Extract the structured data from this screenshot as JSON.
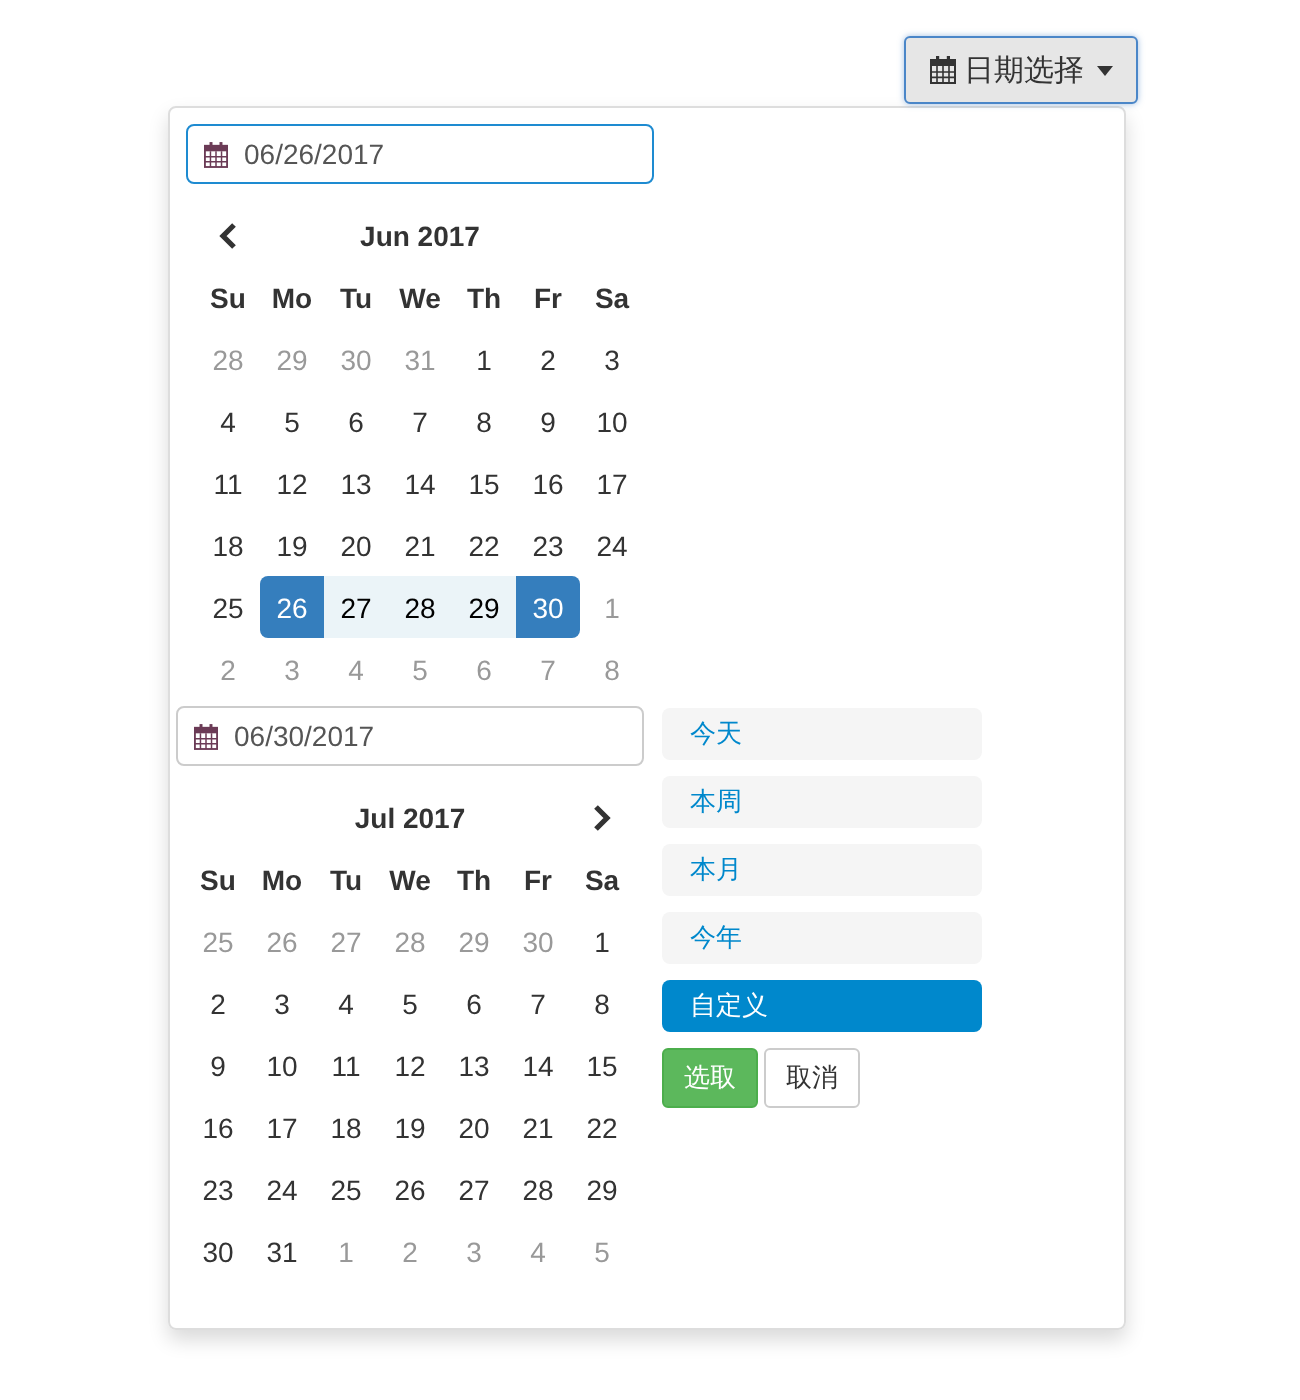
{
  "toggle_button": {
    "label": "日期选择"
  },
  "calendars": [
    {
      "date_field": {
        "value": "06/26/2017",
        "focused": true
      },
      "prev_arrow": true,
      "next_arrow": false,
      "month": "Jun 2017",
      "weekdays": [
        "Su",
        "Mo",
        "Tu",
        "We",
        "Th",
        "Fr",
        "Sa"
      ],
      "weeks": [
        [
          {
            "day": "28",
            "kind": "off"
          },
          {
            "day": "29",
            "kind": "off"
          },
          {
            "day": "30",
            "kind": "off"
          },
          {
            "day": "31",
            "kind": "off"
          },
          {
            "day": "1",
            "kind": "normal"
          },
          {
            "day": "2",
            "kind": "normal"
          },
          {
            "day": "3",
            "kind": "normal"
          }
        ],
        [
          {
            "day": "4",
            "kind": "normal"
          },
          {
            "day": "5",
            "kind": "normal"
          },
          {
            "day": "6",
            "kind": "normal"
          },
          {
            "day": "7",
            "kind": "normal"
          },
          {
            "day": "8",
            "kind": "normal"
          },
          {
            "day": "9",
            "kind": "normal"
          },
          {
            "day": "10",
            "kind": "normal"
          }
        ],
        [
          {
            "day": "11",
            "kind": "normal"
          },
          {
            "day": "12",
            "kind": "normal"
          },
          {
            "day": "13",
            "kind": "normal"
          },
          {
            "day": "14",
            "kind": "normal"
          },
          {
            "day": "15",
            "kind": "normal"
          },
          {
            "day": "16",
            "kind": "normal"
          },
          {
            "day": "17",
            "kind": "normal"
          }
        ],
        [
          {
            "day": "18",
            "kind": "normal"
          },
          {
            "day": "19",
            "kind": "normal"
          },
          {
            "day": "20",
            "kind": "normal"
          },
          {
            "day": "21",
            "kind": "normal"
          },
          {
            "day": "22",
            "kind": "normal"
          },
          {
            "day": "23",
            "kind": "normal"
          },
          {
            "day": "24",
            "kind": "normal"
          }
        ],
        [
          {
            "day": "25",
            "kind": "normal"
          },
          {
            "day": "26",
            "kind": "start"
          },
          {
            "day": "27",
            "kind": "range"
          },
          {
            "day": "28",
            "kind": "range"
          },
          {
            "day": "29",
            "kind": "range"
          },
          {
            "day": "30",
            "kind": "end"
          },
          {
            "day": "1",
            "kind": "off"
          }
        ],
        [
          {
            "day": "2",
            "kind": "off"
          },
          {
            "day": "3",
            "kind": "off"
          },
          {
            "day": "4",
            "kind": "off"
          },
          {
            "day": "5",
            "kind": "off"
          },
          {
            "day": "6",
            "kind": "off"
          },
          {
            "day": "7",
            "kind": "off"
          },
          {
            "day": "8",
            "kind": "off"
          }
        ]
      ]
    },
    {
      "date_field": {
        "value": "06/30/2017",
        "focused": false
      },
      "prev_arrow": false,
      "next_arrow": true,
      "month": "Jul 2017",
      "weekdays": [
        "Su",
        "Mo",
        "Tu",
        "We",
        "Th",
        "Fr",
        "Sa"
      ],
      "weeks": [
        [
          {
            "day": "25",
            "kind": "off"
          },
          {
            "day": "26",
            "kind": "off"
          },
          {
            "day": "27",
            "kind": "off"
          },
          {
            "day": "28",
            "kind": "off"
          },
          {
            "day": "29",
            "kind": "off"
          },
          {
            "day": "30",
            "kind": "off"
          },
          {
            "day": "1",
            "kind": "normal"
          }
        ],
        [
          {
            "day": "2",
            "kind": "normal"
          },
          {
            "day": "3",
            "kind": "normal"
          },
          {
            "day": "4",
            "kind": "normal"
          },
          {
            "day": "5",
            "kind": "normal"
          },
          {
            "day": "6",
            "kind": "normal"
          },
          {
            "day": "7",
            "kind": "normal"
          },
          {
            "day": "8",
            "kind": "normal"
          }
        ],
        [
          {
            "day": "9",
            "kind": "normal"
          },
          {
            "day": "10",
            "kind": "normal"
          },
          {
            "day": "11",
            "kind": "normal"
          },
          {
            "day": "12",
            "kind": "normal"
          },
          {
            "day": "13",
            "kind": "normal"
          },
          {
            "day": "14",
            "kind": "normal"
          },
          {
            "day": "15",
            "kind": "normal"
          }
        ],
        [
          {
            "day": "16",
            "kind": "normal"
          },
          {
            "day": "17",
            "kind": "normal"
          },
          {
            "day": "18",
            "kind": "normal"
          },
          {
            "day": "19",
            "kind": "normal"
          },
          {
            "day": "20",
            "kind": "normal"
          },
          {
            "day": "21",
            "kind": "normal"
          },
          {
            "day": "22",
            "kind": "normal"
          }
        ],
        [
          {
            "day": "23",
            "kind": "normal"
          },
          {
            "day": "24",
            "kind": "normal"
          },
          {
            "day": "25",
            "kind": "normal"
          },
          {
            "day": "26",
            "kind": "normal"
          },
          {
            "day": "27",
            "kind": "normal"
          },
          {
            "day": "28",
            "kind": "normal"
          },
          {
            "day": "29",
            "kind": "normal"
          }
        ],
        [
          {
            "day": "30",
            "kind": "normal"
          },
          {
            "day": "31",
            "kind": "normal"
          },
          {
            "day": "1",
            "kind": "off"
          },
          {
            "day": "2",
            "kind": "off"
          },
          {
            "day": "3",
            "kind": "off"
          },
          {
            "day": "4",
            "kind": "off"
          },
          {
            "day": "5",
            "kind": "off"
          }
        ]
      ]
    }
  ],
  "ranges": [
    {
      "label": "今天",
      "selected": false
    },
    {
      "label": "本周",
      "selected": false
    },
    {
      "label": "本月",
      "selected": false
    },
    {
      "label": "今年",
      "selected": false
    },
    {
      "label": "自定义",
      "selected": true
    }
  ],
  "buttons": [
    {
      "label": "选取",
      "kind": "apply"
    },
    {
      "label": "取消",
      "kind": "cancel"
    }
  ]
}
